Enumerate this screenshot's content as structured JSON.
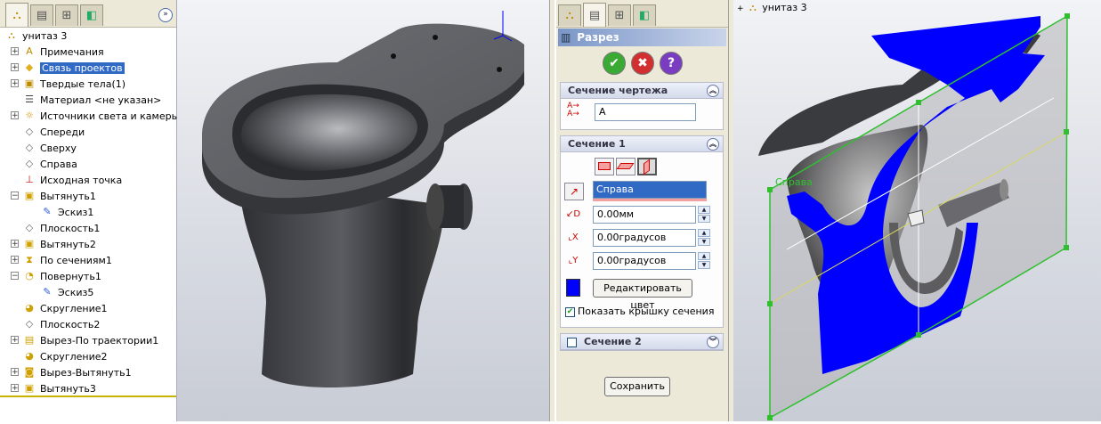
{
  "feature_tree": {
    "root": "унитаз 3",
    "items": [
      {
        "label": "Примечания",
        "icon": "annotations-icon",
        "expander": "+",
        "indent": 0
      },
      {
        "label": "Связь проектов",
        "icon": "design-binder-icon",
        "expander": "+",
        "indent": 0,
        "selected": true
      },
      {
        "label": "Твердые тела(1)",
        "icon": "solid-bodies-icon",
        "expander": "+",
        "indent": 0
      },
      {
        "label": "Материал <не указан>",
        "icon": "material-icon",
        "expander": "",
        "indent": 0
      },
      {
        "label": "Источники света и камеры",
        "icon": "lights-cameras-icon",
        "expander": "+",
        "indent": 0
      },
      {
        "label": "Спереди",
        "icon": "plane-icon",
        "expander": "",
        "indent": 0
      },
      {
        "label": "Сверху",
        "icon": "plane-icon",
        "expander": "",
        "indent": 0
      },
      {
        "label": "Справа",
        "icon": "plane-icon",
        "expander": "",
        "indent": 0
      },
      {
        "label": "Исходная точка",
        "icon": "origin-icon",
        "expander": "",
        "indent": 0
      },
      {
        "label": "Вытянуть1",
        "icon": "extrude-icon",
        "expander": "−",
        "indent": 0
      },
      {
        "label": "Эскиз1",
        "icon": "sketch-icon",
        "expander": "",
        "indent": 1
      },
      {
        "label": "Плоскость1",
        "icon": "plane-icon",
        "expander": "",
        "indent": 0
      },
      {
        "label": "Вытянуть2",
        "icon": "extrude-icon",
        "expander": "+",
        "indent": 0
      },
      {
        "label": "По сечениям1",
        "icon": "loft-icon",
        "expander": "+",
        "indent": 0
      },
      {
        "label": "Повернуть1",
        "icon": "revolve-icon",
        "expander": "−",
        "indent": 0
      },
      {
        "label": "Эскиз5",
        "icon": "sketch-icon",
        "expander": "",
        "indent": 1
      },
      {
        "label": "Скругление1",
        "icon": "fillet-icon",
        "expander": "",
        "indent": 0
      },
      {
        "label": "Плоскость2",
        "icon": "plane-icon",
        "expander": "",
        "indent": 0
      },
      {
        "label": "Вырез-По траектории1",
        "icon": "swept-cut-icon",
        "expander": "+",
        "indent": 0
      },
      {
        "label": "Скругление2",
        "icon": "fillet-icon",
        "expander": "",
        "indent": 0
      },
      {
        "label": "Вырез-Вытянуть1",
        "icon": "extruded-cut-icon",
        "expander": "+",
        "indent": 0
      },
      {
        "label": "Вытянуть3",
        "icon": "extrude-icon",
        "expander": "+",
        "indent": 0
      }
    ]
  },
  "right_tree_label": "унитаз 3",
  "section_view": {
    "title": "Разрез",
    "drawing_section": {
      "header": "Сечение чертежа",
      "value": "A"
    },
    "section1": {
      "header": "Сечение 1",
      "reference": "Справа",
      "offset": "0.00мм",
      "rot_x": "0.00градусов",
      "rot_y": "0.00градусов",
      "edit_color_label": "Редактировать цвет",
      "show_cap_label": "Показать крышку сечения",
      "show_cap_checked": true,
      "cap_color": "#0000ff"
    },
    "section2": {
      "header": "Сечение 2"
    },
    "save_label": "Сохранить"
  },
  "viewport_label": "Справа",
  "colors": {
    "selection": "#316ac5",
    "section_cap": "#0000ff",
    "plane_frame": "#2fbf2f",
    "ok": "#3aaa35",
    "cancel": "#d23030",
    "help": "#7a3cc0"
  }
}
